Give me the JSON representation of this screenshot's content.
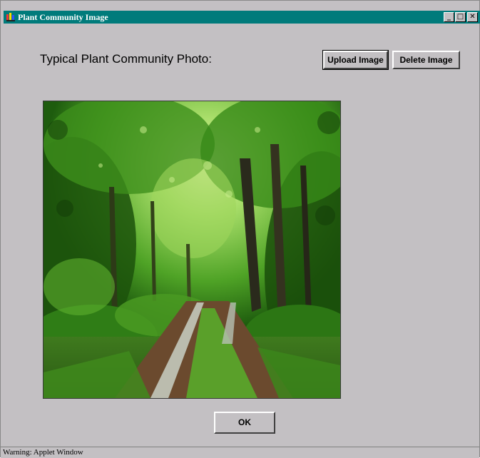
{
  "window": {
    "title": "Plant Community Image",
    "controls": {
      "minimize": "_",
      "maximize": "□",
      "close": "✕"
    }
  },
  "main": {
    "heading": "Typical Plant Community Photo:",
    "upload_label": "Upload Image",
    "delete_label": "Delete Image",
    "photo": {
      "subject": "forest dirt road through green trees"
    },
    "ok_label": "OK"
  },
  "status_bar": {
    "text": "Warning: Applet Window"
  },
  "colors": {
    "titlebar": "#007b7b",
    "window_bg": "#c3c0c3",
    "foliage": "#2f7d16",
    "road": "#6b4a2e"
  }
}
